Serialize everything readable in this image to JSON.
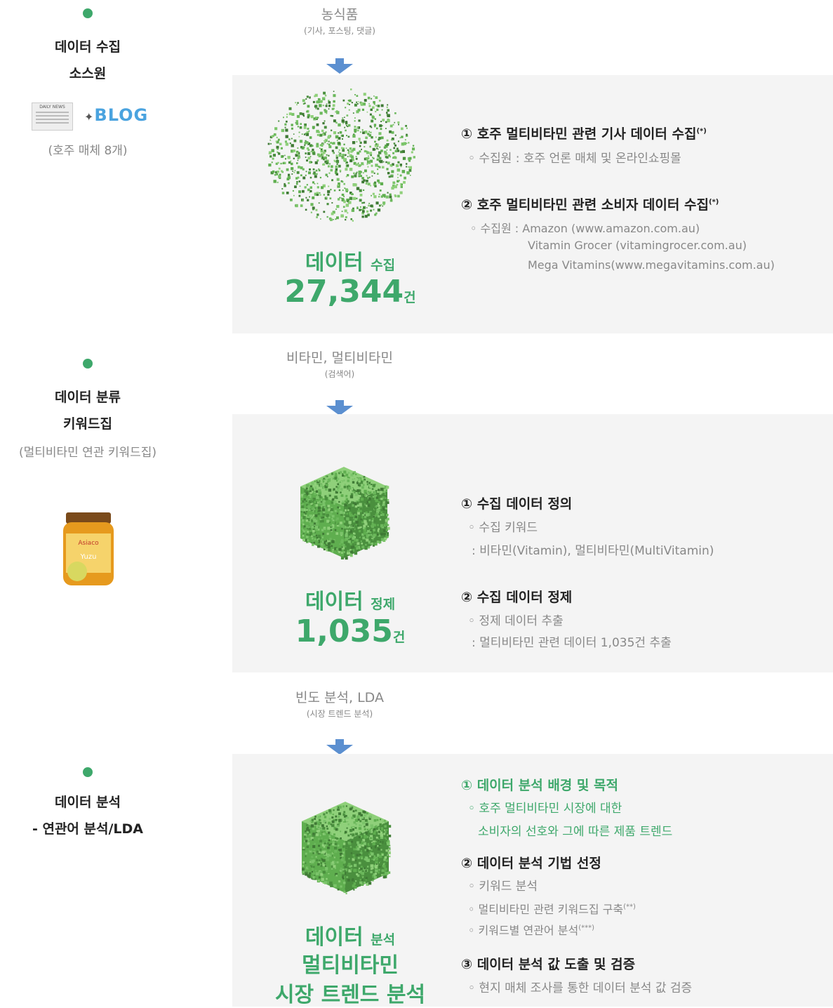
{
  "left": {
    "s1": {
      "title1": "데이터 수집",
      "title2": "소스원",
      "sources_note": "(호주 매체 8개)",
      "newspaper_label": "DAILY NEWS",
      "blog_label": "BLOG"
    },
    "s2": {
      "title1": "데이터 분류",
      "title2": "키워드집",
      "note": "(멀티비타민 연관 키워드집)"
    },
    "s3": {
      "title1": "데이터 분석",
      "title2": "- 연관어 분석/LDA"
    }
  },
  "flow": {
    "f1": {
      "main": "농식품",
      "sub": "(기사, 포스팅, 댓글)"
    },
    "f2": {
      "main": "비타민, 멀티비타민",
      "sub": "(검색어)"
    },
    "f3": {
      "main": "빈도 분석, LDA",
      "sub": "(시장 트렌드 분석)"
    }
  },
  "panel1": {
    "cap_big": "데이터",
    "cap_small": "수집",
    "number": "27,344",
    "unit": "건",
    "h1": "① 호주 멀티비타민 관련 기사 데이터 수집",
    "h1_sup": "(*)",
    "d1": "◦ 수집원 : 호주 언론 매체 및 온라인쇼핑몰",
    "h2": "② 호주 멀티비타민 관련 소비자 데이터 수집",
    "h2_sup": "(*)",
    "d2a": "◦ 수집원 : Amazon (www.amazon.com.au)",
    "d2b": "Vitamin Grocer (vitamingrocer.com.au)",
    "d2c": "Mega Vitamins(www.megavitamins.com.au)"
  },
  "panel2": {
    "cap_big": "데이터",
    "cap_small": "정제",
    "number": "1,035",
    "unit": "건",
    "h1": "① 수집 데이터 정의",
    "d1a": "◦ 수집 키워드",
    "d1b": ": 비타민(Vitamin), 멀티비타민(MultiVitamin)",
    "h2": "② 수집 데이터 정제",
    "d2a": "◦ 정제 데이터 추출",
    "d2b": ": 멀티비타민 관련 데이터 1,035건 추출"
  },
  "panel3": {
    "cap_big": "데이터",
    "cap_small": "분석",
    "cap2": "멀티비타민",
    "cap3": "시장 트렌드 분석",
    "h1": "① 데이터 분석 배경 및 목적",
    "d1a": "◦ 호주 멀티비타민 시장에 대한",
    "d1b": "소비자의 선호와 그에 따른 제품 트렌드",
    "h2": "② 데이터 분석 기법 선정",
    "d2a": "◦ 키워드 분석",
    "d2b": "◦ 멀티비타민 관련 키워드집 구축",
    "d2b_sup": "(**)",
    "d2c": "◦ 키워드별 연관어 분석",
    "d2c_sup": "(***)",
    "h3": "③ 데이터 분석 값 도출 및 검증",
    "d3": "◦ 현지 매체 조사를 통한 데이터 분석 값 검증"
  },
  "colors": {
    "accent": "#3ea86b",
    "arrow": "#5b8fd0",
    "panel": "#f4f4f4"
  }
}
